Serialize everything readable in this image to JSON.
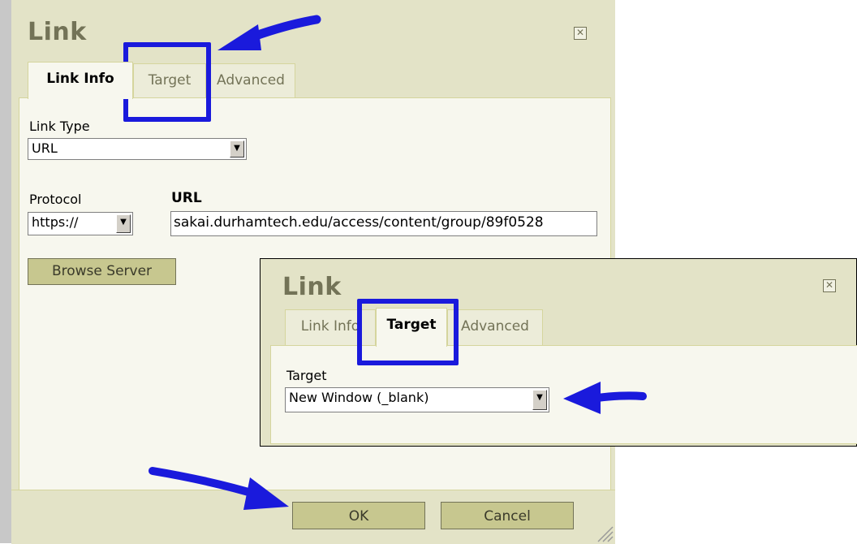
{
  "main_dialog": {
    "title": "Link",
    "close_glyph": "✕",
    "tabs": [
      {
        "label": "Link Info",
        "active": true
      },
      {
        "label": "Target",
        "active": false
      },
      {
        "label": "Advanced",
        "active": false
      }
    ],
    "link_type_label": "Link Type",
    "link_type_value": "URL",
    "protocol_label": "Protocol",
    "protocol_value": "https://",
    "url_label": "URL",
    "url_value": "sakai.durhamtech.edu/access/content/group/89f0528",
    "browse_server_label": "Browse Server",
    "ok_label": "OK",
    "cancel_label": "Cancel"
  },
  "inset_dialog": {
    "title": "Link",
    "close_glyph": "✕",
    "tabs": [
      {
        "label": "Link Info",
        "active": false
      },
      {
        "label": "Target",
        "active": true
      },
      {
        "label": "Advanced",
        "active": false
      }
    ],
    "target_label": "Target",
    "target_value": "New Window (_blank)"
  },
  "icons": {
    "dropdown": "▼",
    "arrow": "blue-arrow-icon",
    "resize": "resize-grip-icon"
  },
  "colors": {
    "dialog_bg": "#e3e3c7",
    "panel_bg": "#f7f7ee",
    "highlight": "#1a1adc",
    "button_bg": "#c7c78f"
  }
}
